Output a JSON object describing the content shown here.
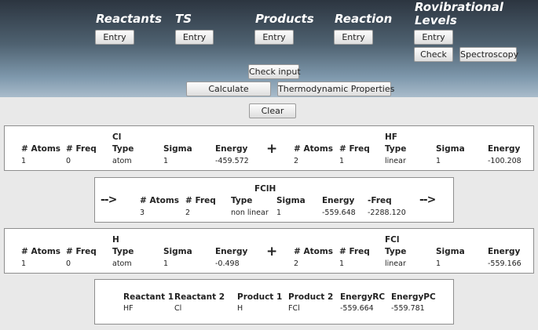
{
  "header": {
    "columns": [
      {
        "title": "Reactants",
        "entry_label": "Entry"
      },
      {
        "title": "TS",
        "entry_label": "Entry"
      },
      {
        "title": "Products",
        "entry_label": "Entry"
      },
      {
        "title": "Reaction",
        "entry_label": "Entry"
      },
      {
        "title_line1": "Rovibrational",
        "title_line2": "Levels",
        "entry_label": "Entry"
      }
    ],
    "check_label": "Check",
    "spectroscopy_label": "Spectroscopy"
  },
  "actions": {
    "check_input_label": "Check input",
    "calculate_label": "Calculate",
    "thermo_label": "Thermodynamic Properties",
    "clear_label": "Clear"
  },
  "reactants": {
    "headers": [
      "# Atoms",
      "# Freq",
      "Type",
      "Sigma",
      "Energy"
    ],
    "operator": "+",
    "left": {
      "name": "Cl",
      "atoms": "1",
      "freq": "0",
      "type": "atom",
      "sigma": "1",
      "energy": "-459.572"
    },
    "right": {
      "name": "HF",
      "atoms": "2",
      "freq": "1",
      "type": "linear",
      "sigma": "1",
      "energy": "-100.208"
    }
  },
  "transition_state": {
    "arrow_left": "-->",
    "arrow_right": "-->",
    "name": "FClH",
    "headers": [
      "# Atoms",
      "# Freq",
      "Type",
      "Sigma",
      "Energy",
      "-Freq"
    ],
    "values": [
      "3",
      "2",
      "non linear",
      "1",
      "-559.648",
      "-2288.120"
    ]
  },
  "products": {
    "headers": [
      "# Atoms",
      "# Freq",
      "Type",
      "Sigma",
      "Energy"
    ],
    "operator": "+",
    "left": {
      "name": "H",
      "atoms": "1",
      "freq": "0",
      "type": "atom",
      "sigma": "1",
      "energy": "-0.498"
    },
    "right": {
      "name": "FCl",
      "atoms": "2",
      "freq": "1",
      "type": "linear",
      "sigma": "1",
      "energy": "-559.166"
    }
  },
  "summary": {
    "headers": [
      "Reactant 1",
      "Reactant 2",
      "Product 1",
      "Product 2",
      "EnergyRC",
      "EnergyPC"
    ],
    "values": [
      "HF",
      "Cl",
      "H",
      "FCl",
      "-559.664",
      "-559.781"
    ]
  }
}
